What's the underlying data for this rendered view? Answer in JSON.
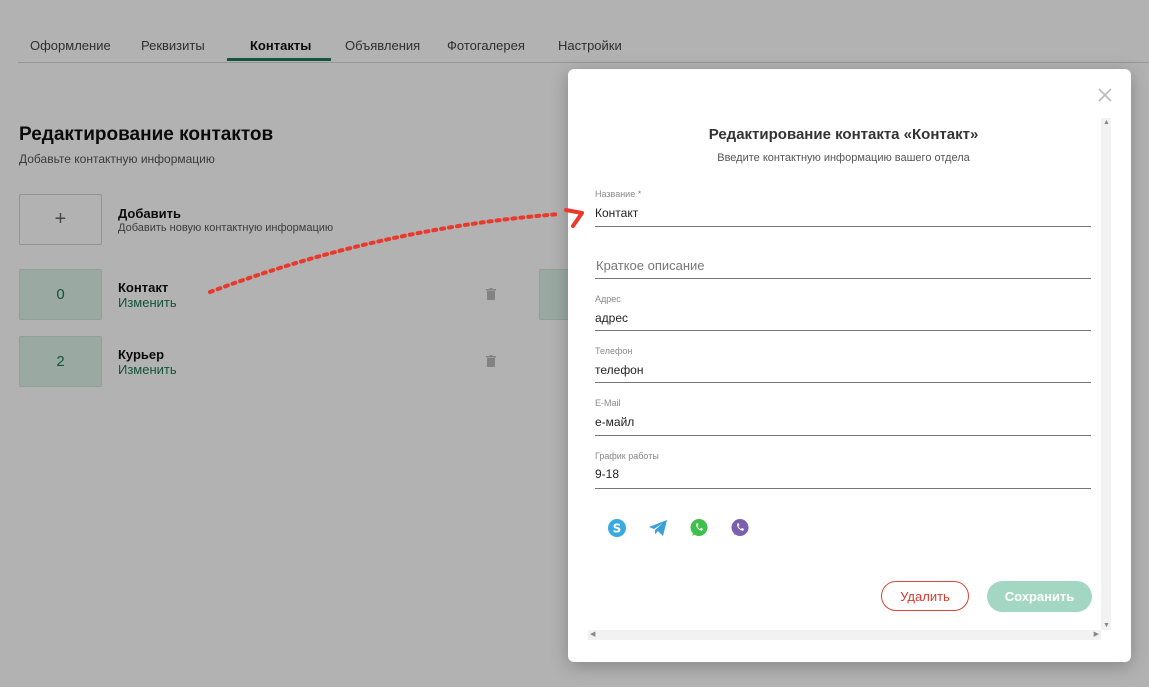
{
  "tabs": [
    {
      "label": "Оформление"
    },
    {
      "label": "Реквизиты"
    },
    {
      "label": "Контакты"
    },
    {
      "label": "Объявления"
    },
    {
      "label": "Фотогалерея"
    },
    {
      "label": "Настройки"
    }
  ],
  "header": {
    "title": "Редактирование контактов",
    "subtitle": "Добавьте контактную информацию"
  },
  "add_item": {
    "icon": "+",
    "label": "Добавить",
    "description": "Добавить новую контактную информацию"
  },
  "contacts": [
    {
      "count": "0",
      "name": "Контакт",
      "action": "Изменить"
    },
    {
      "count": "2",
      "name": "Курьер",
      "action": "Изменить"
    }
  ],
  "modal": {
    "title": "Редактирование контакта «Контакт»",
    "subtitle": "Введите контактную информацию вашего отдела",
    "fields": {
      "name": {
        "label": "Название *",
        "value": "Контакт"
      },
      "description": {
        "placeholder": "Краткое описание"
      },
      "address": {
        "label": "Адрес",
        "value": "адрес"
      },
      "phone": {
        "label": "Телефон",
        "value": "телефон"
      },
      "email": {
        "label": "E-Mail",
        "value": "е-майл"
      },
      "schedule": {
        "label": "График работы",
        "value": "9-18"
      }
    },
    "social_icons": [
      "skype-icon",
      "telegram-icon",
      "whatsapp-icon",
      "viber-icon"
    ],
    "delete_label": "Удалить",
    "save_label": "Сохранить"
  },
  "colors": {
    "accent": "#1a7a55",
    "danger": "#d83a2c",
    "save_disabled": "#a4d7c3",
    "annotation_arrow": "#e8392c"
  }
}
